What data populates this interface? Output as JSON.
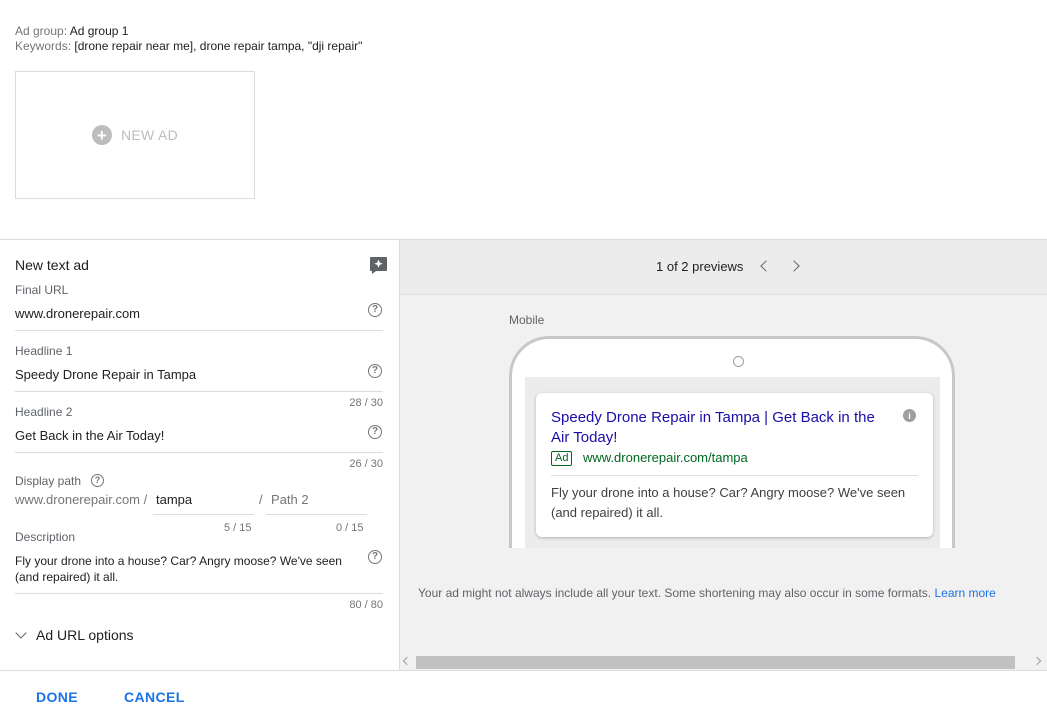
{
  "header": {
    "ad_group_label": "Ad group:",
    "ad_group_value": "Ad group 1",
    "keywords_label": "Keywords:",
    "keywords_value": "[drone repair near me], drone repair tampa, \"dji repair\""
  },
  "new_ad_card": {
    "label": "NEW AD",
    "icon": "plus-circle-icon"
  },
  "editor": {
    "title": "New text ad",
    "final_url": {
      "label": "Final URL",
      "value": "www.dronerepair.com"
    },
    "headline1": {
      "label": "Headline 1",
      "value": "Speedy Drone Repair in Tampa",
      "counter": "28 / 30"
    },
    "headline2": {
      "label": "Headline 2",
      "value": "Get Back in the Air Today!",
      "counter": "26 / 30"
    },
    "display_path": {
      "label": "Display path",
      "prefix": "www.dronerepair.com /",
      "path1_value": "tampa",
      "path1_counter": "5 / 15",
      "separator": "/",
      "path2_placeholder": "Path 2",
      "path2_counter": "0 / 15"
    },
    "description": {
      "label": "Description",
      "value": "Fly your drone into a house? Car? Angry moose? We've seen (and repaired) it all.",
      "counter": "80 / 80"
    },
    "url_options_label": "Ad URL options"
  },
  "preview": {
    "pager_text": "1 of 2 previews",
    "device_label": "Mobile",
    "ad": {
      "headline": "Speedy Drone Repair in Tampa | Get Back in the Air Today!",
      "badge": "Ad",
      "display_url": "www.dronerepair.com/tampa",
      "description": "Fly your drone into a house? Car? Angry moose? We've seen (and repaired) it all."
    },
    "note": "Your ad might not always include all your text. Some shortening may also occur in some formats.",
    "learn_more": "Learn more"
  },
  "footer": {
    "done_label": "DONE",
    "cancel_label": "CANCEL"
  },
  "colors": {
    "accent": "#1a73e8",
    "ad_headline": "#1a0dab",
    "ad_url": "#006621"
  }
}
